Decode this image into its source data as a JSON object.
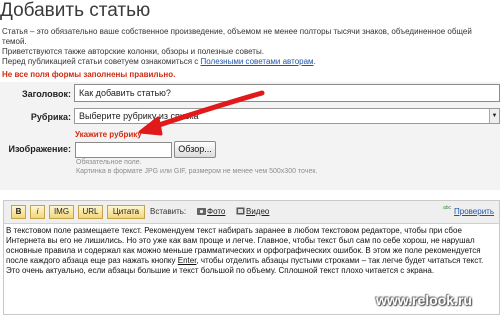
{
  "page": {
    "title": "Добавить статью",
    "intro_line1": "Статья – это обязательно ваше собственное произведение, объемом не менее полторы тысячи знаков, объединенное общей темой.",
    "intro_line2": "Приветствуются также авторские колонки, обзоры и полезные советы.",
    "intro_line3_prefix": "Перед публикацией статьи советуем ознакомиться с ",
    "intro_line3_link": "Полезными советами авторам",
    "intro_line3_suffix": "."
  },
  "form": {
    "error_message": "Не все поля формы заполнены правильно.",
    "title_label": "Заголовок:",
    "title_value": "Как добавить статью?",
    "rubric_label": "Рубрика:",
    "rubric_selected": "Выберите рубрику из списка",
    "rubric_warning": "Укажите рубрику",
    "image_label": "Изображение:",
    "browse_button": "Обзор...",
    "image_required": "Обязательное поле.",
    "image_hint": "Картинка в формате JPG или GIF, размером не менее чем 500x300 точек."
  },
  "toolbar": {
    "bold": "B",
    "italic": "i",
    "img": "IMG",
    "url": "URL",
    "quote": "Цитата",
    "insert_label": "Вставить:",
    "photo_link": "Фото",
    "video_link": "Видео",
    "check_link": "Проверить",
    "check_icon_text": "abc"
  },
  "editor": {
    "text_part1": "В текстовом поле размещаете текст. Рекомендуем текст набирать заранее в любом текстовом редакторе, чтобы при сбое Интернета вы его не лишились. Но это уже как вам проще и легче. Главное, чтобы текст был сам по себе хорош, не нарушал основные правила и содержал как можно меньше грамматических и орфографических ошибок. В этом же поле рекомендуется после каждого абзаца еще раз нажать кнопку ",
    "text_key": "Enter",
    "text_part2": ", чтобы отделить абзацы пустыми строками – так легче будет читаться текст. Это очень актуально, если абзацы большие и текст большой по объему. Сплошной текст плохо читается с экрана."
  },
  "watermark": "www.relook.ru",
  "colors": {
    "error": "#d12a12",
    "link": "#1e54a8",
    "form_bg": "#f3f3f3",
    "toolbar_button": "#f1d77b",
    "arrow": "#e01a1a"
  }
}
